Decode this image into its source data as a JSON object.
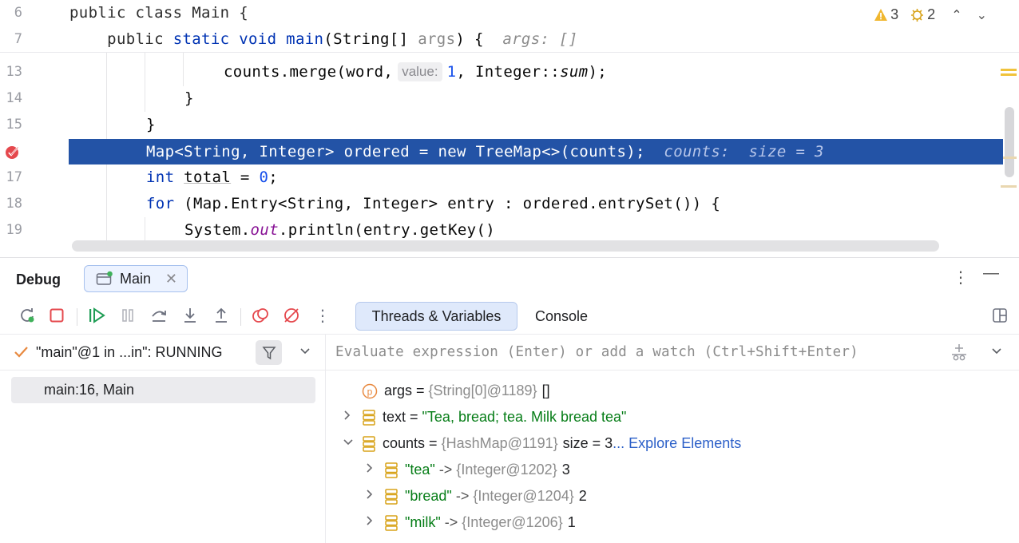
{
  "editor": {
    "sticky_lines": [
      {
        "num": "6",
        "text": "public class Main {"
      },
      {
        "num": "7",
        "text": "    public static void main(String[] args) {",
        "hint": "args: []"
      }
    ],
    "lines": [
      {
        "num": "13",
        "before": "counts.merge(word,",
        "inlay": "value:",
        "value": "1",
        "after": ", Integer::",
        "method": "sum",
        "end": ");"
      },
      {
        "num": "14",
        "text": "}"
      },
      {
        "num": "15",
        "text": "}"
      },
      {
        "num": "16",
        "exec_text": "Map<String, Integer> ordered = new TreeMap<>(counts);",
        "exec_hint": "counts:  size = 3"
      },
      {
        "num": "17",
        "kw": "int",
        "var": "total",
        "rest": " = ",
        "value": "0",
        "end": ";"
      },
      {
        "num": "18",
        "kw": "for",
        "rest": " (Map.Entry<String, Integer> entry : ordered.entrySet()) {"
      },
      {
        "num": "19",
        "obj": "System.",
        "field": "out",
        "rest": ".println(entry.getKey()"
      }
    ],
    "inspections": {
      "warnings": "3",
      "weak_warnings": "2"
    }
  },
  "debug": {
    "title": "Debug",
    "session_tab": "Main",
    "tabs": [
      "Threads & Variables",
      "Console"
    ],
    "thread": "\"main\"@1 in ...in\": RUNNING",
    "frame": "main:16, Main",
    "evaluate_placeholder": "Evaluate expression (Enter) or add a watch (Ctrl+Shift+Enter)",
    "variables": [
      {
        "name": "args",
        "kind": "param",
        "type": "{String[0]@1189}",
        "value": "[]"
      },
      {
        "name": "text",
        "kind": "field",
        "expandable": true,
        "string": "\"Tea, bread; tea. Milk bread tea\""
      },
      {
        "name": "counts",
        "kind": "field",
        "expanded": true,
        "type": "{HashMap@1191}",
        "value": "size = 3",
        "link": "... Explore Elements"
      },
      {
        "key": "\"tea\"",
        "arrow": "->",
        "type": "{Integer@1202}",
        "value": "3"
      },
      {
        "key": "\"bread\"",
        "arrow": "->",
        "type": "{Integer@1204}",
        "value": "2"
      },
      {
        "key": "\"milk\"",
        "arrow": "->",
        "type": "{Integer@1206}",
        "value": "1"
      }
    ]
  },
  "colors": {
    "execution_line": "#2353a6",
    "keyword": "#0033b3",
    "string": "#067d17",
    "link": "#2b5fc8",
    "stop": "#e5484d",
    "resume": "#1f9d55"
  }
}
